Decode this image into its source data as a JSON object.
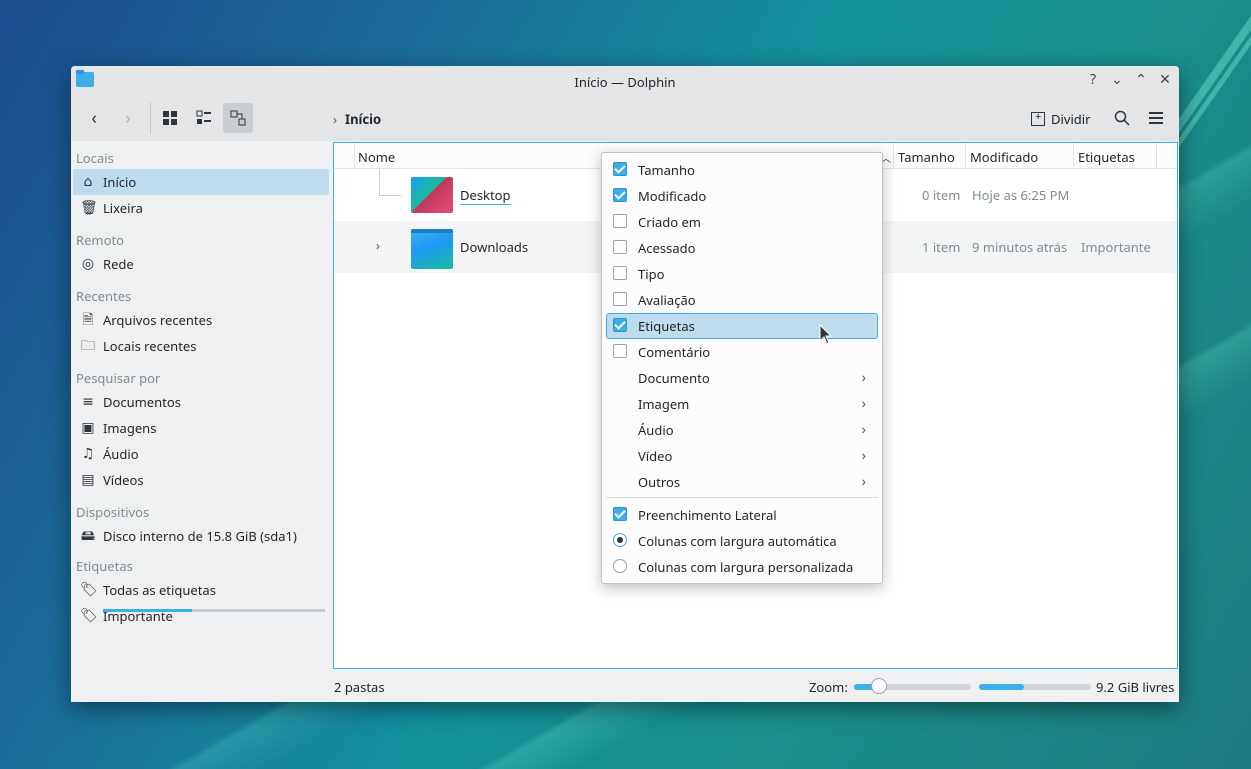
{
  "window": {
    "title": "Início — Dolphin",
    "controls": [
      "?",
      "⌄",
      "⌃",
      "✕"
    ]
  },
  "toolbar": {
    "breadcrumb": "Início",
    "split_label": "Dividir"
  },
  "sidebar": {
    "sections": {
      "locais": "Locais",
      "remoto": "Remoto",
      "recentes": "Recentes",
      "pesquisar": "Pesquisar por",
      "dispositivos": "Dispositivos",
      "etiquetas": "Etiquetas"
    },
    "items": {
      "inicio": "Início",
      "lixeira": "Lixeira",
      "rede": "Rede",
      "arquivos_recentes": "Arquivos recentes",
      "locais_recentes": "Locais recentes",
      "documentos": "Documentos",
      "imagens": "Imagens",
      "audio": "Áudio",
      "videos": "Vídeos",
      "disco": "Disco interno de 15.8 GiB (sda1)",
      "todas_etiquetas": "Todas as etiquetas",
      "importante": "Importante"
    }
  },
  "columns": {
    "nome": "Nome",
    "tamanho": "Tamanho",
    "modificado": "Modificado",
    "etiquetas": "Etiquetas"
  },
  "rows": [
    {
      "name": "Desktop",
      "size": "0 item",
      "modified": "Hoje as 6:25 PM",
      "tags": ""
    },
    {
      "name": "Downloads",
      "size": "1 item",
      "modified": "9 minutos atrás",
      "tags": "Importante"
    }
  ],
  "status": {
    "count": "2 pastas",
    "zoom_label": "Zoom:",
    "free_space": "9.2 GiB livres"
  },
  "context_menu": {
    "tamanho": "Tamanho",
    "modificado": "Modificado",
    "criado_em": "Criado em",
    "acessado": "Acessado",
    "tipo": "Tipo",
    "avaliacao": "Avaliação",
    "etiquetas": "Etiquetas",
    "comentario": "Comentário",
    "documento": "Documento",
    "imagem": "Imagem",
    "audio": "Áudio",
    "video": "Vídeo",
    "outros": "Outros",
    "preenchimento": "Preenchimento Lateral",
    "auto_width": "Colunas com largura automática",
    "custom_width": "Colunas com largura personalizada"
  },
  "colors": {
    "accent": "#3daee9",
    "selection": "#bfdcef"
  }
}
